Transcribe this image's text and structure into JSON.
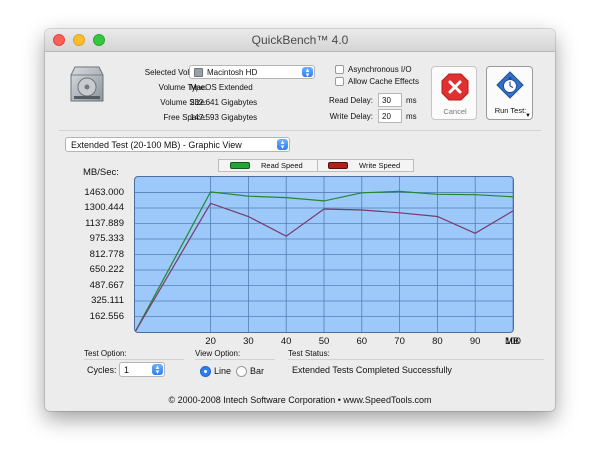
{
  "window": {
    "title": "QuickBench™ 4.0"
  },
  "volume": {
    "selected_label": "Selected Volume:",
    "selected_value": "Macintosh HD",
    "type_label": "Volume Type:",
    "type_value": "MacOS Extended",
    "size_label": "Volume Size:",
    "size_value": "232.641 Gigabytes",
    "free_label": "Free Space:",
    "free_value": "147.593 Gigabytes"
  },
  "options": {
    "async_label": "Asynchronous I/O",
    "async_checked": false,
    "cache_label": "Allow Cache Effects",
    "cache_checked": false,
    "read_delay_label": "Read Delay:",
    "read_delay_value": "30",
    "write_delay_label": "Write Delay:",
    "write_delay_value": "20",
    "unit": "ms"
  },
  "buttons": {
    "cancel_label": "Cancel",
    "run_label": "Run Test:"
  },
  "test_mode": "Extended Test (20-100 MB) - Graphic View",
  "legend": {
    "read": "Read Speed",
    "write": "Write Speed"
  },
  "chart_data": {
    "type": "line",
    "ylabel": "MB/Sec:",
    "xlabel": "MB",
    "x": [
      0,
      20,
      30,
      40,
      50,
      60,
      70,
      80,
      90,
      100
    ],
    "xlim": [
      0,
      100
    ],
    "ylim": [
      0,
      1626
    ],
    "yticks": [
      "1463.000",
      "1300.444",
      "1137.889",
      "975.333",
      "812.778",
      "650.222",
      "487.667",
      "325.111",
      "162.556"
    ],
    "ytick_values": [
      1463.0,
      1300.444,
      1137.889,
      975.333,
      812.778,
      650.222,
      487.667,
      325.111,
      162.556
    ],
    "xticks": [
      "20",
      "30",
      "40",
      "50",
      "60",
      "70",
      "80",
      "90",
      "100"
    ],
    "xtick_values": [
      20,
      30,
      40,
      50,
      60,
      70,
      80,
      90,
      100
    ],
    "grid": true,
    "series": [
      {
        "name": "Read Speed",
        "color": "#1e8a2e",
        "values": [
          0,
          1470,
          1425,
          1410,
          1375,
          1460,
          1475,
          1445,
          1440,
          1418
        ]
      },
      {
        "name": "Write Speed",
        "color": "#7a3a6a",
        "values": [
          0,
          1350,
          1212,
          1005,
          1290,
          1280,
          1250,
          1212,
          1035,
          1270
        ]
      }
    ]
  },
  "controls": {
    "test_option_label": "Test Option:",
    "cycles_label": "Cycles:",
    "cycles_value": "1",
    "view_option_label": "View Option:",
    "view_line": "Line",
    "view_bar": "Bar",
    "view_selected": "Line",
    "status_label": "Test Status:",
    "status_value": "Extended Tests Completed Successfully"
  },
  "footer": "© 2000-2008 Intech Software Corporation • www.SpeedTools.com",
  "colors": {
    "chart_bg": "#9cc8fa",
    "grid": "#557fb8",
    "accent": "#2f7fef",
    "cancel_red": "#e03030"
  }
}
